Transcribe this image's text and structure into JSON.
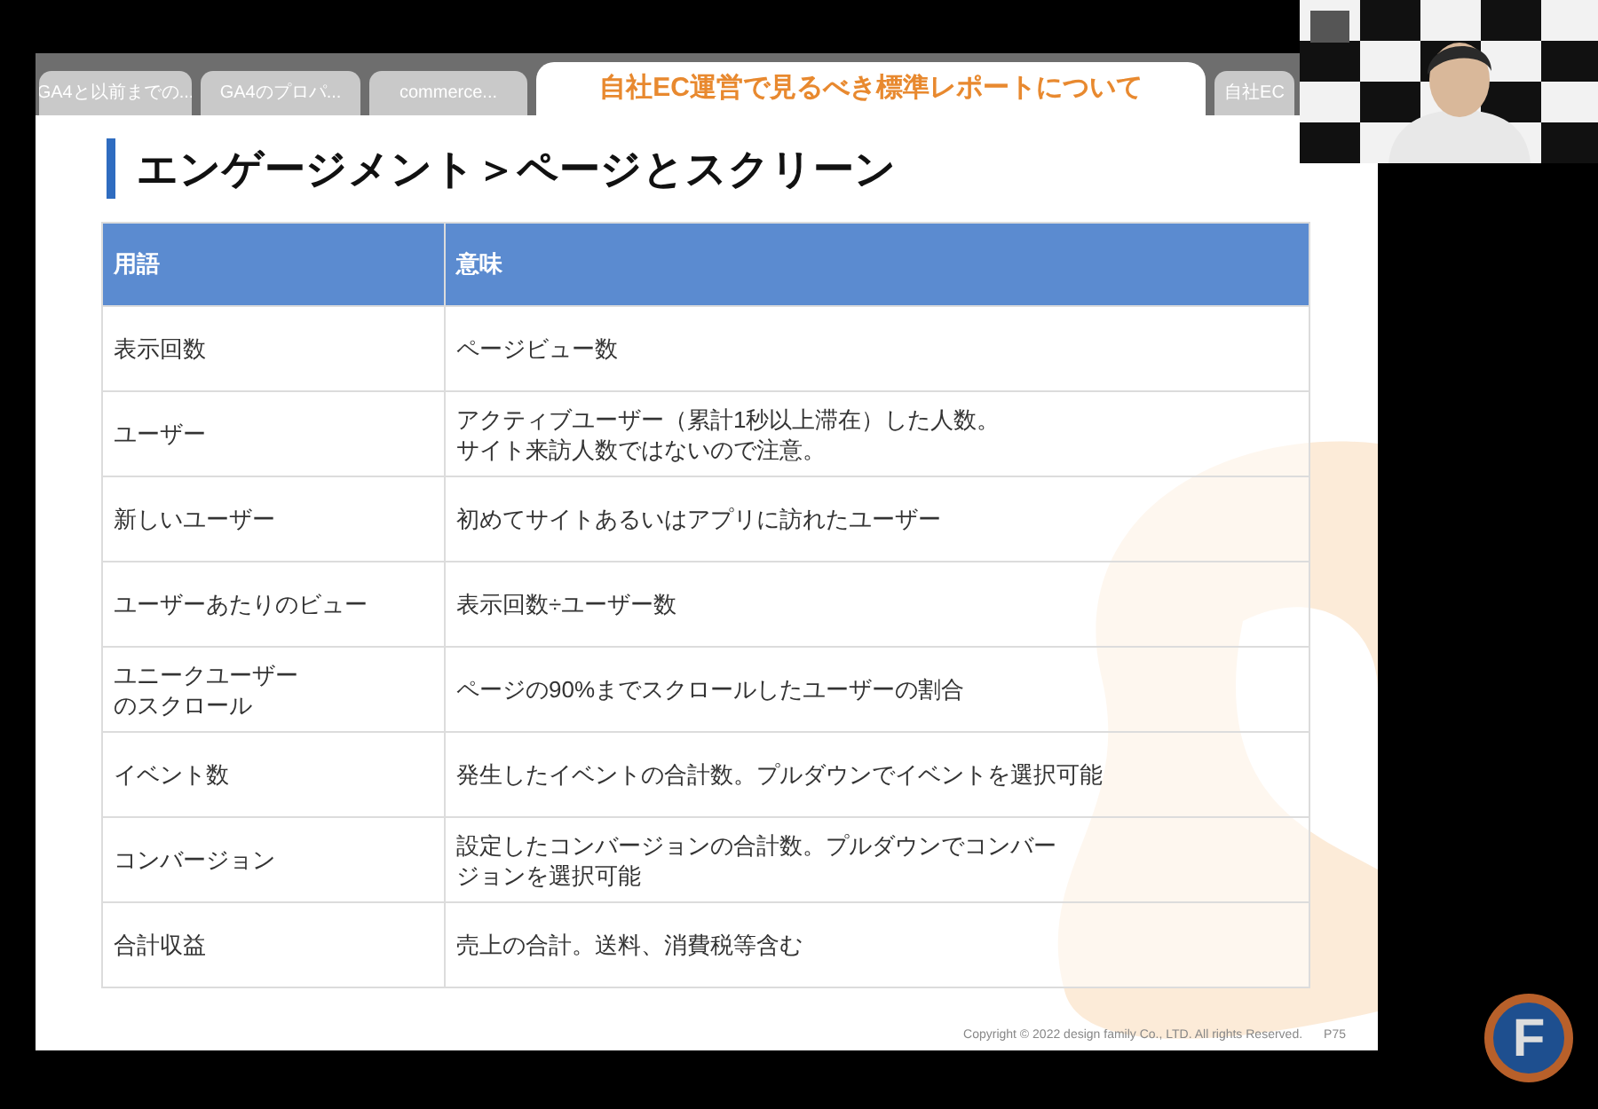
{
  "tabs": [
    {
      "label": "GA4と以前までの...",
      "selected": false
    },
    {
      "label": "GA4のプロパ...",
      "selected": false
    },
    {
      "label": "commerce...",
      "selected": false
    },
    {
      "label": "自社EC運営で見るべき標準レポートについて",
      "selected": true
    },
    {
      "label": "自社EC",
      "selected": false
    }
  ],
  "slide": {
    "title": "エンゲージメント＞ページとスクリーン",
    "table": {
      "columns": [
        "用語",
        "意味"
      ],
      "rows": [
        [
          "表示回数",
          "ページビュー数"
        ],
        [
          "ユーザー",
          [
            "アクティブユーザー（累計1秒以上滞在）した人数。",
            "サイト来訪人数ではないので注意。"
          ]
        ],
        [
          "新しいユーザー",
          "初めてサイトあるいはアプリに訪れたユーザー"
        ],
        [
          "ユーザーあたりのビュー",
          "表示回数÷ユーザー数"
        ],
        [
          [
            "ユニークユーザー",
            "のスクロール"
          ],
          "ページの90%までスクロールしたユーザーの割合"
        ],
        [
          "イベント数",
          "発生したイベントの合計数。プルダウンでイベントを選択可能"
        ],
        [
          "コンバージョン",
          [
            "設定したコンバージョンの合計数。プルダウンでコンバー",
            "ジョンを選択可能"
          ]
        ],
        [
          "合計収益",
          "売上の合計。送料、消費税等含む"
        ]
      ]
    },
    "copyright": "Copyright © 2022 design family Co., LTD. All rights Reserved.",
    "page": "P75"
  },
  "logo": {
    "letter": "F"
  }
}
